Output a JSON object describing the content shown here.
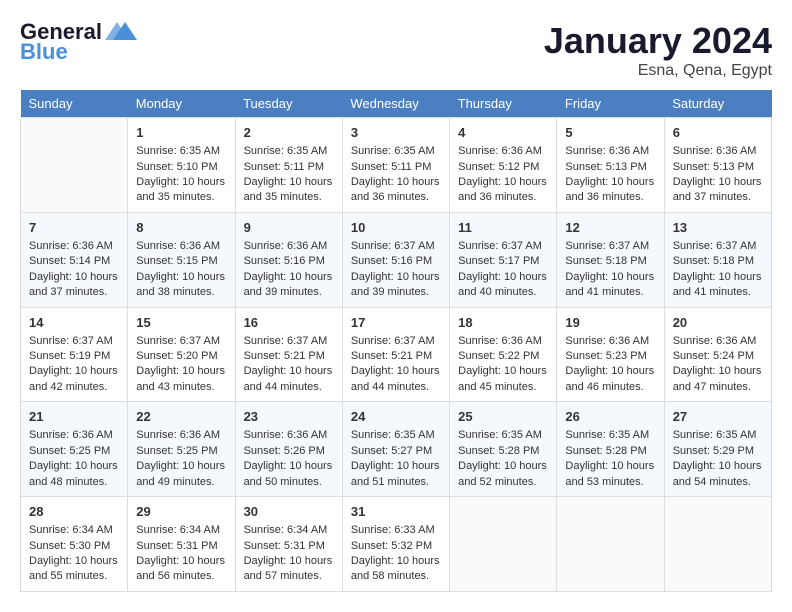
{
  "header": {
    "logo_line1": "General",
    "logo_line2": "Blue",
    "title": "January 2024",
    "subtitle": "Esna, Qena, Egypt"
  },
  "calendar": {
    "headers": [
      "Sunday",
      "Monday",
      "Tuesday",
      "Wednesday",
      "Thursday",
      "Friday",
      "Saturday"
    ],
    "weeks": [
      [
        {
          "num": "",
          "sunrise": "",
          "sunset": "",
          "daylight": ""
        },
        {
          "num": "1",
          "sunrise": "Sunrise: 6:35 AM",
          "sunset": "Sunset: 5:10 PM",
          "daylight": "Daylight: 10 hours and 35 minutes."
        },
        {
          "num": "2",
          "sunrise": "Sunrise: 6:35 AM",
          "sunset": "Sunset: 5:11 PM",
          "daylight": "Daylight: 10 hours and 35 minutes."
        },
        {
          "num": "3",
          "sunrise": "Sunrise: 6:35 AM",
          "sunset": "Sunset: 5:11 PM",
          "daylight": "Daylight: 10 hours and 36 minutes."
        },
        {
          "num": "4",
          "sunrise": "Sunrise: 6:36 AM",
          "sunset": "Sunset: 5:12 PM",
          "daylight": "Daylight: 10 hours and 36 minutes."
        },
        {
          "num": "5",
          "sunrise": "Sunrise: 6:36 AM",
          "sunset": "Sunset: 5:13 PM",
          "daylight": "Daylight: 10 hours and 36 minutes."
        },
        {
          "num": "6",
          "sunrise": "Sunrise: 6:36 AM",
          "sunset": "Sunset: 5:13 PM",
          "daylight": "Daylight: 10 hours and 37 minutes."
        }
      ],
      [
        {
          "num": "7",
          "sunrise": "Sunrise: 6:36 AM",
          "sunset": "Sunset: 5:14 PM",
          "daylight": "Daylight: 10 hours and 37 minutes."
        },
        {
          "num": "8",
          "sunrise": "Sunrise: 6:36 AM",
          "sunset": "Sunset: 5:15 PM",
          "daylight": "Daylight: 10 hours and 38 minutes."
        },
        {
          "num": "9",
          "sunrise": "Sunrise: 6:36 AM",
          "sunset": "Sunset: 5:16 PM",
          "daylight": "Daylight: 10 hours and 39 minutes."
        },
        {
          "num": "10",
          "sunrise": "Sunrise: 6:37 AM",
          "sunset": "Sunset: 5:16 PM",
          "daylight": "Daylight: 10 hours and 39 minutes."
        },
        {
          "num": "11",
          "sunrise": "Sunrise: 6:37 AM",
          "sunset": "Sunset: 5:17 PM",
          "daylight": "Daylight: 10 hours and 40 minutes."
        },
        {
          "num": "12",
          "sunrise": "Sunrise: 6:37 AM",
          "sunset": "Sunset: 5:18 PM",
          "daylight": "Daylight: 10 hours and 41 minutes."
        },
        {
          "num": "13",
          "sunrise": "Sunrise: 6:37 AM",
          "sunset": "Sunset: 5:18 PM",
          "daylight": "Daylight: 10 hours and 41 minutes."
        }
      ],
      [
        {
          "num": "14",
          "sunrise": "Sunrise: 6:37 AM",
          "sunset": "Sunset: 5:19 PM",
          "daylight": "Daylight: 10 hours and 42 minutes."
        },
        {
          "num": "15",
          "sunrise": "Sunrise: 6:37 AM",
          "sunset": "Sunset: 5:20 PM",
          "daylight": "Daylight: 10 hours and 43 minutes."
        },
        {
          "num": "16",
          "sunrise": "Sunrise: 6:37 AM",
          "sunset": "Sunset: 5:21 PM",
          "daylight": "Daylight: 10 hours and 44 minutes."
        },
        {
          "num": "17",
          "sunrise": "Sunrise: 6:37 AM",
          "sunset": "Sunset: 5:21 PM",
          "daylight": "Daylight: 10 hours and 44 minutes."
        },
        {
          "num": "18",
          "sunrise": "Sunrise: 6:36 AM",
          "sunset": "Sunset: 5:22 PM",
          "daylight": "Daylight: 10 hours and 45 minutes."
        },
        {
          "num": "19",
          "sunrise": "Sunrise: 6:36 AM",
          "sunset": "Sunset: 5:23 PM",
          "daylight": "Daylight: 10 hours and 46 minutes."
        },
        {
          "num": "20",
          "sunrise": "Sunrise: 6:36 AM",
          "sunset": "Sunset: 5:24 PM",
          "daylight": "Daylight: 10 hours and 47 minutes."
        }
      ],
      [
        {
          "num": "21",
          "sunrise": "Sunrise: 6:36 AM",
          "sunset": "Sunset: 5:25 PM",
          "daylight": "Daylight: 10 hours and 48 minutes."
        },
        {
          "num": "22",
          "sunrise": "Sunrise: 6:36 AM",
          "sunset": "Sunset: 5:25 PM",
          "daylight": "Daylight: 10 hours and 49 minutes."
        },
        {
          "num": "23",
          "sunrise": "Sunrise: 6:36 AM",
          "sunset": "Sunset: 5:26 PM",
          "daylight": "Daylight: 10 hours and 50 minutes."
        },
        {
          "num": "24",
          "sunrise": "Sunrise: 6:35 AM",
          "sunset": "Sunset: 5:27 PM",
          "daylight": "Daylight: 10 hours and 51 minutes."
        },
        {
          "num": "25",
          "sunrise": "Sunrise: 6:35 AM",
          "sunset": "Sunset: 5:28 PM",
          "daylight": "Daylight: 10 hours and 52 minutes."
        },
        {
          "num": "26",
          "sunrise": "Sunrise: 6:35 AM",
          "sunset": "Sunset: 5:28 PM",
          "daylight": "Daylight: 10 hours and 53 minutes."
        },
        {
          "num": "27",
          "sunrise": "Sunrise: 6:35 AM",
          "sunset": "Sunset: 5:29 PM",
          "daylight": "Daylight: 10 hours and 54 minutes."
        }
      ],
      [
        {
          "num": "28",
          "sunrise": "Sunrise: 6:34 AM",
          "sunset": "Sunset: 5:30 PM",
          "daylight": "Daylight: 10 hours and 55 minutes."
        },
        {
          "num": "29",
          "sunrise": "Sunrise: 6:34 AM",
          "sunset": "Sunset: 5:31 PM",
          "daylight": "Daylight: 10 hours and 56 minutes."
        },
        {
          "num": "30",
          "sunrise": "Sunrise: 6:34 AM",
          "sunset": "Sunset: 5:31 PM",
          "daylight": "Daylight: 10 hours and 57 minutes."
        },
        {
          "num": "31",
          "sunrise": "Sunrise: 6:33 AM",
          "sunset": "Sunset: 5:32 PM",
          "daylight": "Daylight: 10 hours and 58 minutes."
        },
        {
          "num": "",
          "sunrise": "",
          "sunset": "",
          "daylight": ""
        },
        {
          "num": "",
          "sunrise": "",
          "sunset": "",
          "daylight": ""
        },
        {
          "num": "",
          "sunrise": "",
          "sunset": "",
          "daylight": ""
        }
      ]
    ]
  }
}
